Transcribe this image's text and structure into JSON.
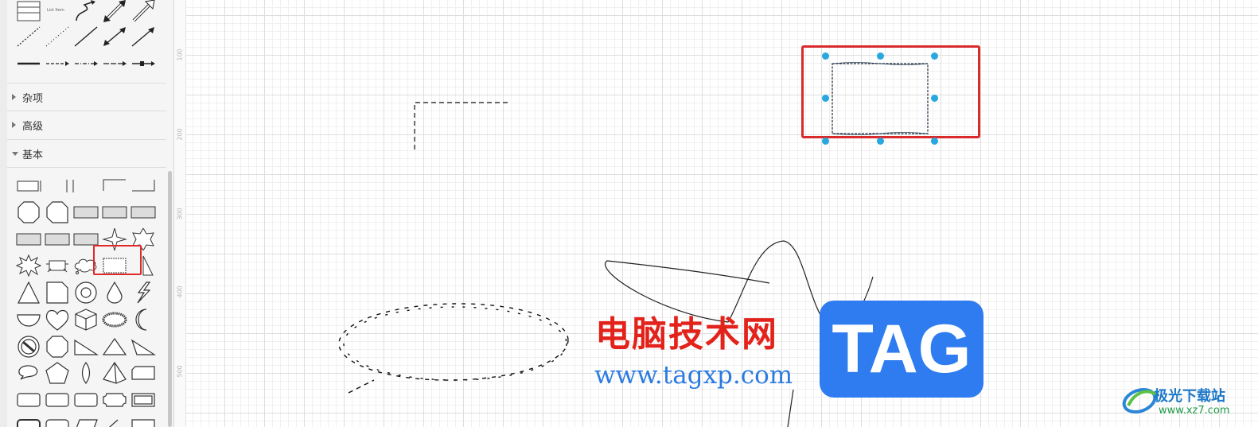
{
  "sidebar": {
    "tiny_labels": [
      "List Item"
    ],
    "sections": [
      {
        "label": "杂项",
        "expanded": false
      },
      {
        "label": "高级",
        "expanded": false
      },
      {
        "label": "基本",
        "expanded": true
      }
    ],
    "top_shapes": [
      "table-shape",
      "list-item-shape",
      "curve-arrow-shape",
      "bidirectional-double-arrow-shape",
      "double-arrow-shape",
      "dashed-line-shape",
      "dotted-line-shape",
      "line-shape",
      "bidirectional-arrow-shape",
      "arrow-shape",
      "thick-line-shape",
      "dashed-arrow-shape",
      "dash-dot-arrow-shape",
      "long-dash-arrow-shape",
      "connector-arrow-shape"
    ],
    "basic_shapes": [
      "rectangle-bracket-shape",
      "partial-rectangle-shape",
      "corner-left-shape",
      "corner-right-shape",
      "octagon-shape",
      "cut-corner-shape",
      "flat-rectangle-1",
      "flat-rectangle-2",
      "flat-rectangle-3",
      "flat-rectangle-4",
      "flat-rectangle-5",
      "flat-rectangle-6",
      "four-point-star-shape",
      "six-point-star-shape",
      "explosion-shape",
      "banner-shape",
      "cloud-callout-shape",
      "sketch-rectangle-shape",
      "cone-shape",
      "triangle-shape",
      "note-shape",
      "ring-shape",
      "drop-shape",
      "lightning-shape",
      "half-circle-shape",
      "heart-shape",
      "cube-shape",
      "wavy-ellipse-shape",
      "moon-shape",
      "no-symbol-shape",
      "octagon-shape-2",
      "right-triangle-shape",
      "isosceles-triangle-shape",
      "obtuse-triangle-shape",
      "speech-bubble-shape",
      "pentagon-shape",
      "lens-shape",
      "pyramid-shape",
      "card-shape",
      "rounded-rectangle-shape",
      "rounded-rectangle-2",
      "rounded-rectangle-3",
      "plaque-shape",
      "frame-shape"
    ]
  },
  "ruler": {
    "labels": [
      "100",
      "200",
      "300",
      "400",
      "500"
    ]
  },
  "watermark": {
    "site_title": "电脑技术网",
    "site_url": "www.tagxp.com",
    "tag_logo": "TAG",
    "brand_name": "极光下载站",
    "brand_url": "www.xz7.com"
  },
  "colors": {
    "highlight": "#e02a27",
    "handle": "#29a8e0",
    "tag_blue": "#2f7cf0",
    "watermark_red": "#e3231b"
  }
}
